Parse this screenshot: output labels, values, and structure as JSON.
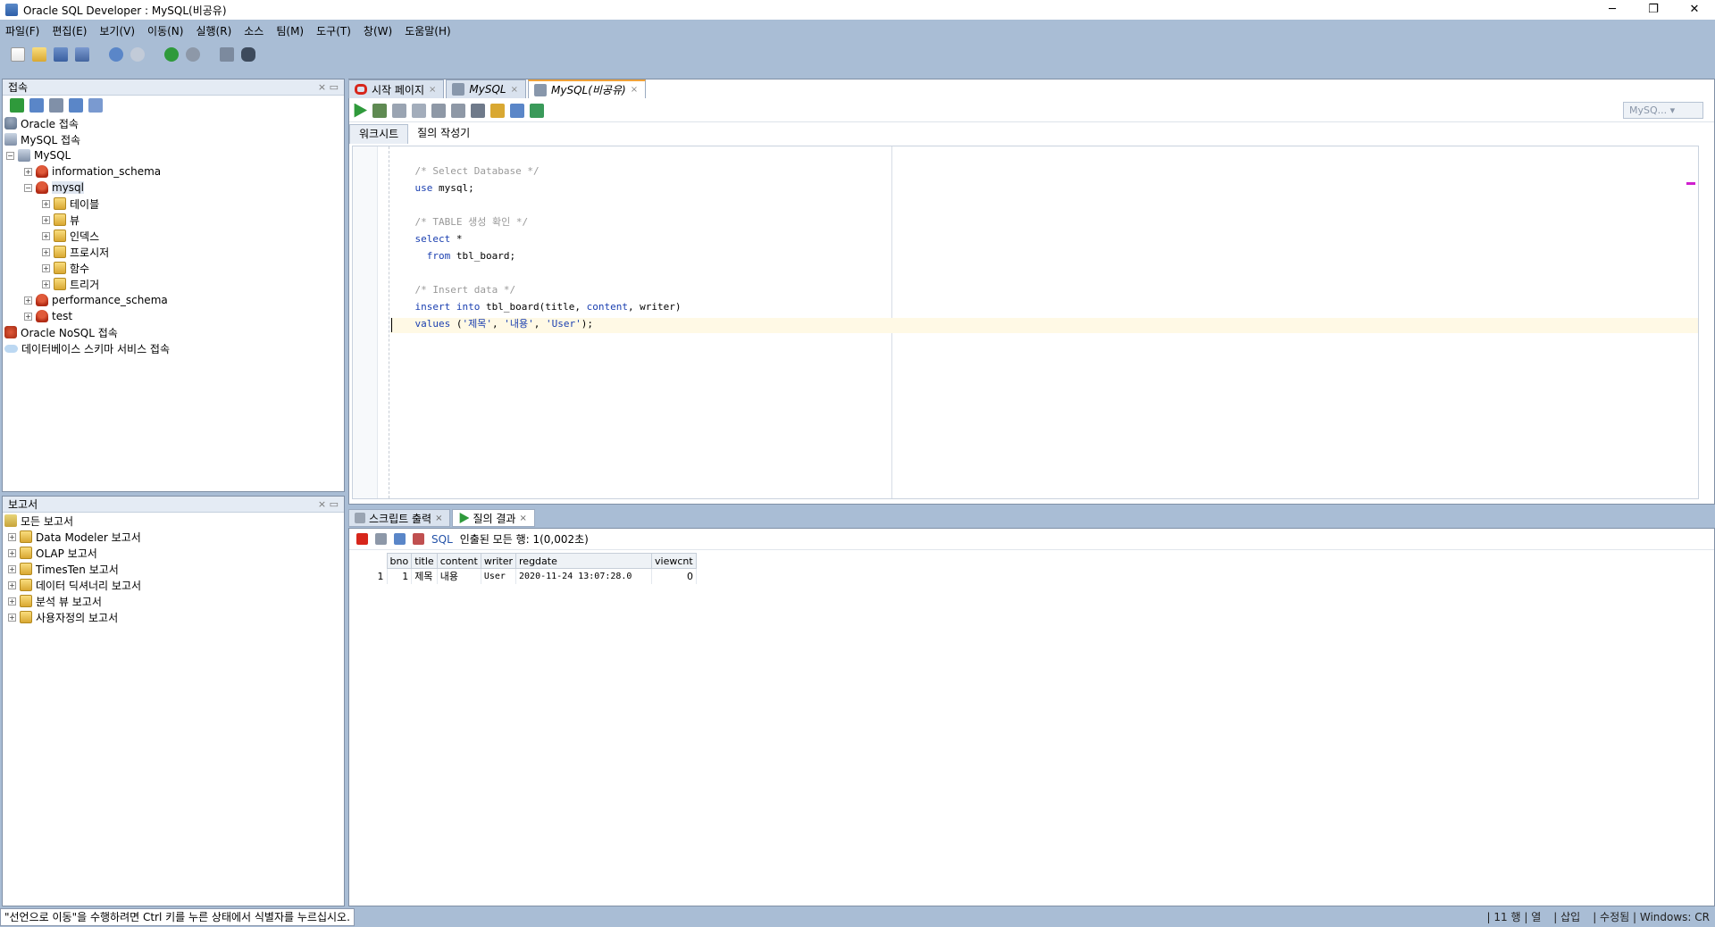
{
  "window": {
    "title": "Oracle SQL Developer : MySQL(비공유)",
    "minimize": "─",
    "restore": "❐",
    "close": "✕"
  },
  "menu": [
    "파일(F)",
    "편집(E)",
    "보기(V)",
    "이동(N)",
    "실행(R)",
    "소스",
    "팀(M)",
    "도구(T)",
    "창(W)",
    "도움말(H)"
  ],
  "connections_pane": {
    "title": "접속",
    "tree": {
      "oracle": "Oracle 접속",
      "mysql_conn": "MySQL 접속",
      "mysql": "MySQL",
      "information_schema": "information_schema",
      "mysql_db": "mysql",
      "tables": "테이블",
      "views": "뷰",
      "indexes": "인덱스",
      "procedures": "프로시저",
      "functions": "함수",
      "triggers": "트리거",
      "performance_schema": "performance_schema",
      "test": "test",
      "nosql": "Oracle NoSQL 접속",
      "schema_service": "데이터베이스 스키마 서비스 접속"
    }
  },
  "reports_pane": {
    "title": "보고서",
    "items": [
      "모든 보고서",
      "Data Modeler 보고서",
      "OLAP 보고서",
      "TimesTen 보고서",
      "데이터 딕셔너리 보고서",
      "분석 뷰 보고서",
      "사용자정의 보고서"
    ]
  },
  "doc_tabs": {
    "start": "시작 페이지",
    "mysql": "MySQL",
    "mysql_unshared": "MySQL(비공유)"
  },
  "editor": {
    "connection_select": "MySQ...",
    "subtabs": {
      "worksheet": "워크시트",
      "query_builder": "질의 작성기"
    },
    "lines": {
      "l1": "/* Select Database */",
      "l2_kw": "use",
      "l2_rest": " mysql;",
      "l4": "/* TABLE 생성 확인 */",
      "l5_kw": "select",
      "l5_rest": " *",
      "l6_kw": "  from",
      "l6_rest": " tbl_board;",
      "l8": "/* Insert data */",
      "l9_kw1": "insert into",
      "l9_rest1": " tbl_board(title, ",
      "l9_kw2": "content",
      "l9_rest2": ", writer)",
      "l10_kw": "values",
      "l10_rest1": " (",
      "l10_s1": "'제목'",
      "l10_c1": ", ",
      "l10_s2": "'내용'",
      "l10_c2": ", ",
      "l10_s3": "'User'",
      "l10_rest2": ");"
    }
  },
  "output": {
    "tabs": {
      "script_output": "스크립트 출력",
      "query_result": "질의 결과"
    },
    "toolbar": {
      "sql": "SQL",
      "status": "인출된 모든 행: 1(0,002초)"
    },
    "columns": [
      "bno",
      "title",
      "content",
      "writer",
      "regdate",
      "viewcnt"
    ],
    "rows": [
      {
        "rownum": "1",
        "bno": "1",
        "title": "제목",
        "content": "내용",
        "writer": "User",
        "regdate": "2020-11-24 13:07:28.0",
        "viewcnt": "0"
      }
    ]
  },
  "statusbar": {
    "message": "\"선언으로 이동\"을 수행하려면 Ctrl 키를 누른 상태에서 식별자를 누르십시오.",
    "position": "| 11 행 | 열",
    "insert": "| 삽입",
    "modified": "| 수정됨 | Windows: CR"
  }
}
